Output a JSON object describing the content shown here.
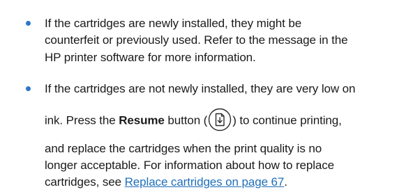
{
  "bullets": [
    {
      "lines": [
        "If the cartridges are newly installed, they might be",
        "counterfeit or previously used. Refer to the message in the",
        "HP printer software for more information."
      ]
    },
    {
      "line1": "If the cartridges are not newly installed, they are very low on",
      "line2_before": "ink. Press the ",
      "line2_bold": "Resume",
      "line2_mid": " button (",
      "line2_after": ") to continue printing,",
      "line3": "and replace the cartridges when the print quality is no",
      "line4": "longer acceptable. For information about how to replace",
      "line5_before": "cartridges, see ",
      "line5_link": "Replace cartridges on page 67",
      "line5_after": "."
    }
  ],
  "icons": {
    "bullet": "bullet-dot",
    "resume": "resume-button-icon"
  },
  "colors": {
    "bullet": "#2f76c6",
    "link": "#1f6fb8",
    "text": "#1a1a1a"
  }
}
